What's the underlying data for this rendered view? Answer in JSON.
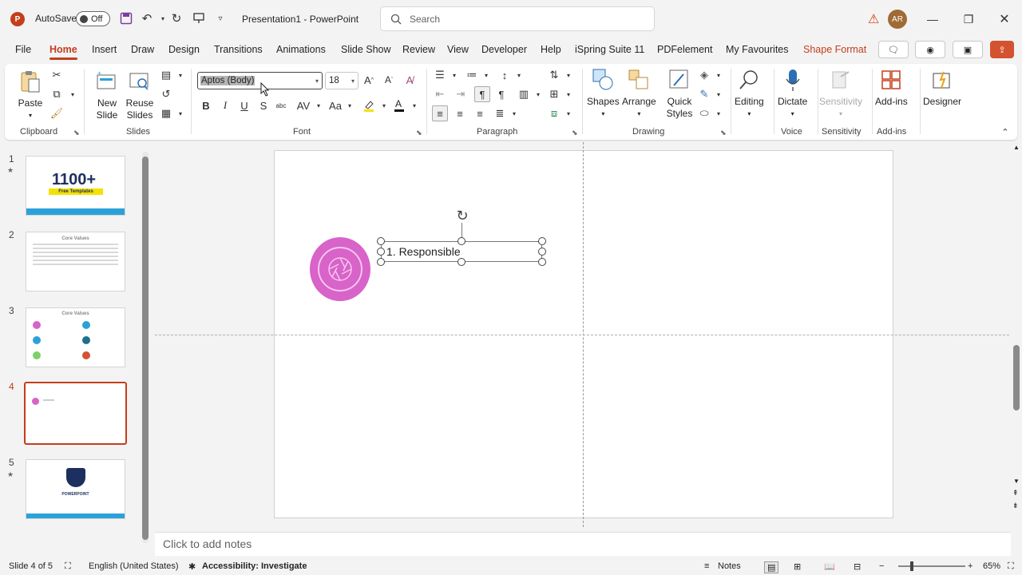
{
  "titlebar": {
    "app_logo": "P",
    "autosave_label": "AutoSave",
    "autosave_state": "Off",
    "doc_title": "Presentation1  -  PowerPoint",
    "search_placeholder": "Search",
    "user_initials": "AR"
  },
  "menu": {
    "tabs": [
      "File",
      "Home",
      "Insert",
      "Draw",
      "Design",
      "Transitions",
      "Animations",
      "Slide Show",
      "Review",
      "View",
      "Developer",
      "Help",
      "iSpring Suite 11",
      "PDFelement",
      "My Favourites",
      "Shape Format"
    ],
    "active_tab": "Home"
  },
  "ribbon": {
    "clipboard": {
      "paste": "Paste",
      "label": "Clipboard"
    },
    "slides": {
      "new_slide": "New Slide",
      "reuse_slides": "Reuse Slides",
      "label": "Slides"
    },
    "font": {
      "font_name": "Aptos (Body)",
      "font_size": "18",
      "label": "Font"
    },
    "paragraph": {
      "label": "Paragraph"
    },
    "drawing": {
      "shapes": "Shapes",
      "arrange": "Arrange",
      "quick_styles": "Quick Styles",
      "label": "Drawing"
    },
    "editing": {
      "label": "Editing"
    },
    "voice": {
      "dictate": "Dictate",
      "label": "Voice"
    },
    "sensitivity": {
      "button": "Sensitivity",
      "label": "Sensitivity"
    },
    "addins": {
      "button": "Add-ins",
      "label": "Add-ins"
    },
    "designer": {
      "button": "Designer"
    }
  },
  "thumbnails": {
    "numbers": [
      "1",
      "2",
      "3",
      "4",
      "5"
    ],
    "slide1_title": "1100+",
    "slide1_banner": "Free Templates",
    "slide2_title": "Core Values",
    "slide3_title": "Core Values",
    "slide5_title": "POWERPOINT"
  },
  "slide": {
    "textbox_text": "1. Responsible",
    "circle_color": "#d863c9"
  },
  "notes": {
    "placeholder": "Click to add notes"
  },
  "status": {
    "slide_of": "Slide 4 of 5",
    "language": "English (United States)",
    "accessibility": "Accessibility: Investigate",
    "notes_btn": "Notes",
    "zoom": "65%"
  },
  "colors": {
    "accent": "#c43e1c",
    "contextual_tab": "#c43e1c"
  }
}
